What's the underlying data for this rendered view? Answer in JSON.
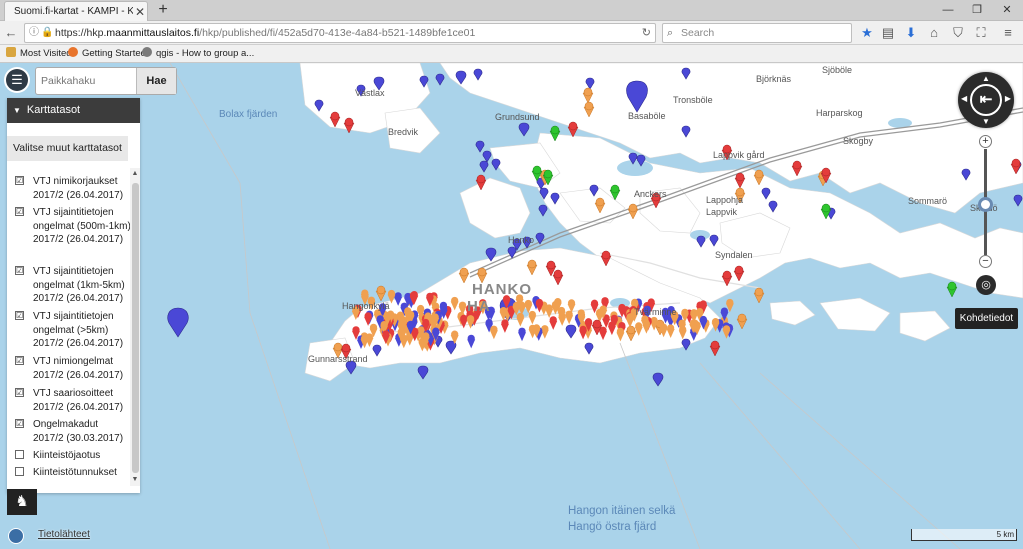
{
  "browser": {
    "tab_title": "Suomi.fi-kartat - KAMPI - Karttat",
    "tab_close": "✕",
    "new_tab": "+",
    "url_prefix": "https://hkp.",
    "url_domain": "maanmittauslaitos.fi",
    "url_path": "/hkp/published/fi/452a5d70-413e-4a84-b521-1489bfe1ce01",
    "search_placeholder": "Search",
    "bookmarks": [
      "Most Visited",
      "Getting Started",
      "qgis - How to group a..."
    ]
  },
  "app": {
    "search_placeholder": "Paikkahaku",
    "search_button": "Hae",
    "panel_title": "Karttatasot",
    "other_maps": "Valitse muut karttatasot",
    "layers": [
      {
        "label": "VTJ nimikorjaukset 2017/2 (26.04.2017)",
        "checked": true,
        "check": "☑"
      },
      {
        "label": "VTJ sijaintitietojen ongelmat (500m-1km) 2017/2 (26.04.2017)",
        "checked": true,
        "check": "☑"
      },
      {
        "label": "VTJ sijaintitietojen ongelmat (1km-5km) 2017/2 (26.04.2017)",
        "checked": true,
        "check": "☑"
      },
      {
        "label": "VTJ sijaintitietojen ongelmat (>5km) 2017/2 (26.04.2017)",
        "checked": true,
        "check": "☑"
      },
      {
        "label": "VTJ nimiongelmat 2017/2 (26.04.2017)",
        "checked": true,
        "check": "☑"
      },
      {
        "label": "VTJ saariosoitteet 2017/2 (26.04.2017)",
        "checked": true,
        "check": "☑"
      },
      {
        "label": "Ongelmakadut 2017/2 (30.03.2017)",
        "checked": true,
        "check": "☑"
      },
      {
        "label": "Kiinteistöjaotus",
        "checked": false,
        "check": ""
      },
      {
        "label": "Kiinteistötunnukset",
        "checked": false,
        "check": ""
      }
    ],
    "source_link": "Tietolähteet",
    "tooltip": "Kohdetiedot",
    "scale": "5 km",
    "place_labels": [
      "Västlax",
      "Bredvik",
      "Grundsund",
      "Basaböle",
      "Tronsböle",
      "Björknäs",
      "Sjöböle",
      "Harparskog",
      "Skogby",
      "Lappvik gård",
      "Anckers",
      "Lappohja",
      "Lappvik",
      "Syndalen",
      "Sommarö",
      "Skåldö",
      "Hangonkylä",
      "Tvärminne",
      "Gunnarsstrand",
      "Hanko",
      "Bolax fjärden",
      "Hangon itäinen selkä",
      "Hangö östra fjärd"
    ],
    "hanko_label": "HANKO",
    "hanko_label2": "HA"
  },
  "colors": {
    "water": "#aad3ea",
    "land": "#ffffff",
    "pin_blue": "#4a48d6",
    "pin_orange": "#f0a050",
    "pin_red": "#e43c3c",
    "pin_green": "#2ec52e"
  }
}
